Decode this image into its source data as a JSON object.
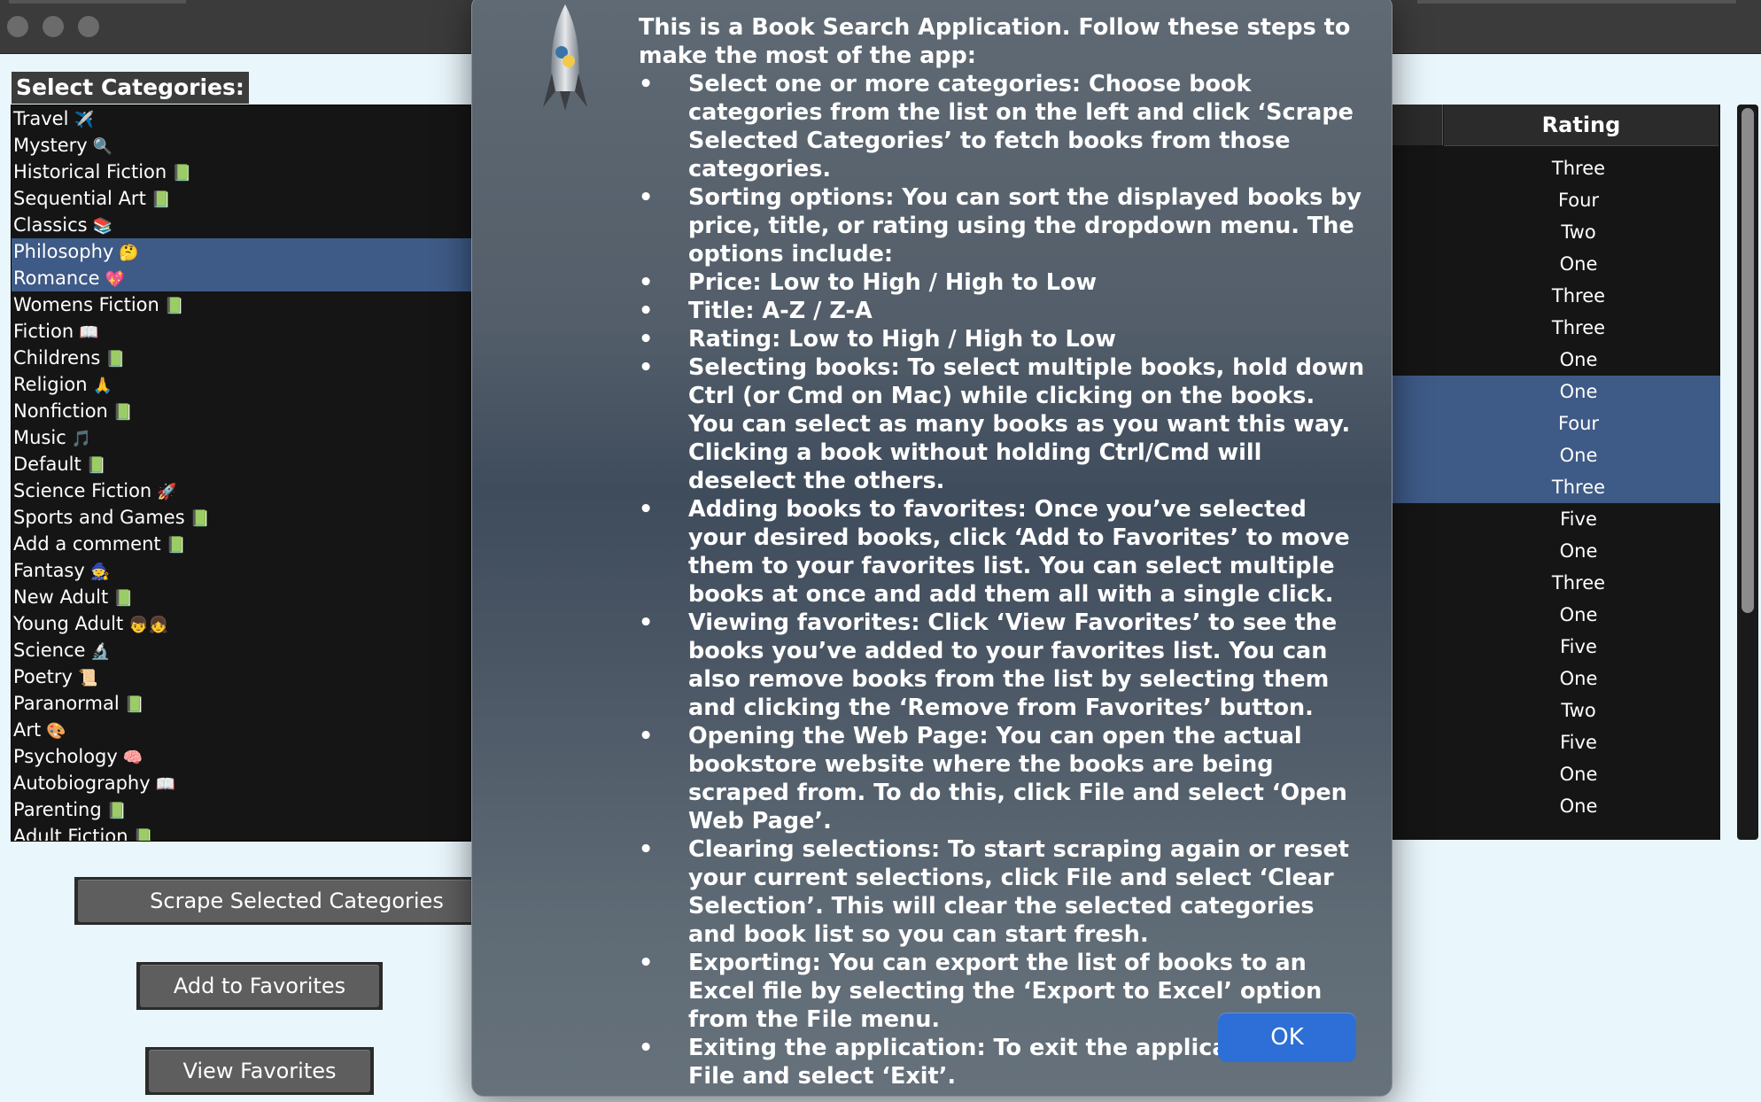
{
  "categories": {
    "header": "Select Categories:",
    "items": [
      {
        "label": "Travel",
        "icon": "✈️",
        "selected": false
      },
      {
        "label": "Mystery",
        "icon": "🔍",
        "selected": false
      },
      {
        "label": "Historical Fiction",
        "icon": "📗",
        "selected": false
      },
      {
        "label": "Sequential Art",
        "icon": "📗",
        "selected": false
      },
      {
        "label": "Classics",
        "icon": "📚",
        "selected": false
      },
      {
        "label": "Philosophy",
        "icon": "🤔",
        "selected": true
      },
      {
        "label": "Romance",
        "icon": "💖",
        "selected": true
      },
      {
        "label": "Womens Fiction",
        "icon": "📗",
        "selected": false
      },
      {
        "label": "Fiction",
        "icon": "📖",
        "selected": false
      },
      {
        "label": "Childrens",
        "icon": "📗",
        "selected": false
      },
      {
        "label": "Religion",
        "icon": "🙏",
        "selected": false
      },
      {
        "label": "Nonfiction",
        "icon": "📗",
        "selected": false
      },
      {
        "label": "Music",
        "icon": "🎵",
        "selected": false
      },
      {
        "label": "Default",
        "icon": "📗",
        "selected": false
      },
      {
        "label": "Science Fiction",
        "icon": "🚀",
        "selected": false
      },
      {
        "label": "Sports and Games",
        "icon": "📗",
        "selected": false
      },
      {
        "label": "Add a comment",
        "icon": "📗",
        "selected": false
      },
      {
        "label": "Fantasy",
        "icon": "🧙",
        "selected": false
      },
      {
        "label": "New Adult",
        "icon": "📗",
        "selected": false
      },
      {
        "label": "Young Adult",
        "icon": "👦👧",
        "selected": false
      },
      {
        "label": "Science",
        "icon": "🔬",
        "selected": false
      },
      {
        "label": "Poetry",
        "icon": "📜",
        "selected": false
      },
      {
        "label": "Paranormal",
        "icon": "📗",
        "selected": false
      },
      {
        "label": "Art",
        "icon": "🎨",
        "selected": false
      },
      {
        "label": "Psychology",
        "icon": "🧠",
        "selected": false
      },
      {
        "label": "Autobiography",
        "icon": "📖",
        "selected": false
      },
      {
        "label": "Parenting",
        "icon": "📗",
        "selected": false
      },
      {
        "label": "Adult Fiction",
        "icon": "📗",
        "selected": false
      }
    ]
  },
  "buttons": {
    "scrape": "Scrape Selected Categories",
    "add_favorites": "Add to Favorites",
    "view_favorites": "View Favorites"
  },
  "table": {
    "rating_header": "Rating",
    "rows": [
      {
        "rating": "Three",
        "selected": false
      },
      {
        "rating": "Four",
        "selected": false
      },
      {
        "rating": "Two",
        "selected": false
      },
      {
        "rating": "One",
        "selected": false
      },
      {
        "rating": "Three",
        "selected": false
      },
      {
        "rating": "Three",
        "selected": false
      },
      {
        "rating": "One",
        "selected": false
      },
      {
        "rating": "One",
        "selected": true
      },
      {
        "rating": "Four",
        "selected": true
      },
      {
        "rating": "One",
        "selected": true
      },
      {
        "rating": "Three",
        "selected": true
      },
      {
        "rating": "Five",
        "selected": false
      },
      {
        "rating": "One",
        "selected": false
      },
      {
        "rating": "Three",
        "selected": false
      },
      {
        "rating": "One",
        "selected": false
      },
      {
        "rating": "Five",
        "selected": false
      },
      {
        "rating": "One",
        "selected": false
      },
      {
        "rating": "Two",
        "selected": false
      },
      {
        "rating": "Five",
        "selected": false
      },
      {
        "rating": "One",
        "selected": false
      },
      {
        "rating": "One",
        "selected": false
      }
    ]
  },
  "dialog": {
    "icon": "rocket-python-icon",
    "ok_label": "OK",
    "intro": "This is a Book Search Application. Follow these steps to make the most of the app:",
    "bullets": [
      "Select one or more categories: Choose book categories from the list on the left and click ‘Scrape Selected Categories’ to fetch books from those categories.",
      "Sorting options: You can sort the displayed books by price, title, or rating using the dropdown menu. The options include:",
      "Price: Low to High / High to Low",
      "Title: A-Z / Z-A",
      "Rating: Low to High / High to Low",
      "Selecting books: To select multiple books, hold down Ctrl (or Cmd on Mac) while clicking on the books. You can select as many books as you want this way. Clicking a book without holding Ctrl/Cmd will deselect the others.",
      "Adding books to favorites: Once you’ve selected your desired books, click ‘Add to Favorites’ to move them to your favorites list. You can select multiple books at once and add them all with a single click.",
      "Viewing favorites: Click ‘View Favorites’ to see the books you’ve added to your favorites list. You can also remove books from the list by selecting them and clicking the ‘Remove from Favorites’ button.",
      "Opening the Web Page: You can open the actual bookstore website where the books are being scraped from. To do this, click File and select ‘Open Web Page’.",
      "Clearing selections: To start scraping again or reset your current selections, click File and select ‘Clear Selection’. This will clear the selected categories and book list so you can start fresh.",
      "Exporting: You can export the list of books to an Excel file by selecting the ‘Export to Excel’ option from the File menu.",
      "Exiting the application: To exit the application, click File and select ‘Exit’."
    ]
  },
  "colors": {
    "selection": "#3e5a86",
    "ok_button": "#2d6fd6",
    "window_bg": "#e9f6fb"
  }
}
